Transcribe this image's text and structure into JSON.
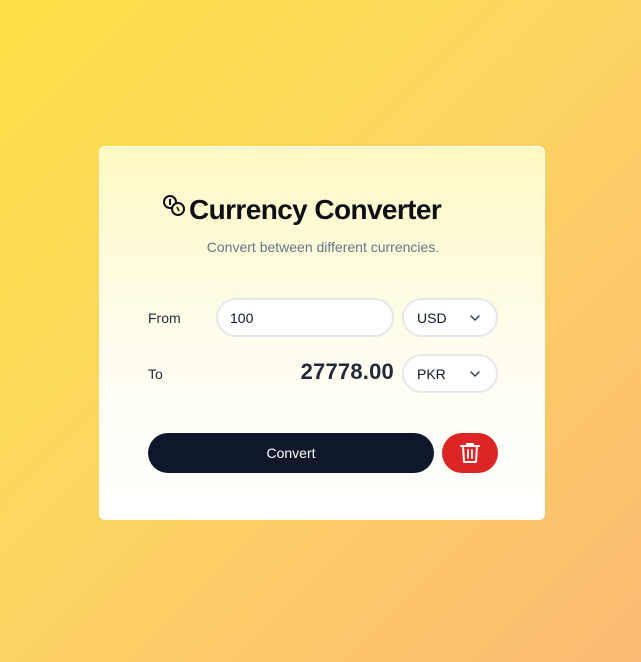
{
  "header": {
    "icon": "coins-icon",
    "title": "Currency Converter",
    "subtitle": "Convert between different currencies."
  },
  "from": {
    "label": "From",
    "amount": "100",
    "currency": "USD"
  },
  "to": {
    "label": "To",
    "result": "27778.00",
    "currency": "PKR"
  },
  "actions": {
    "convert_label": "Convert",
    "delete_icon": "trash-icon"
  },
  "colors": {
    "convert_button": "#0f172a",
    "delete_button": "#dc2626"
  }
}
